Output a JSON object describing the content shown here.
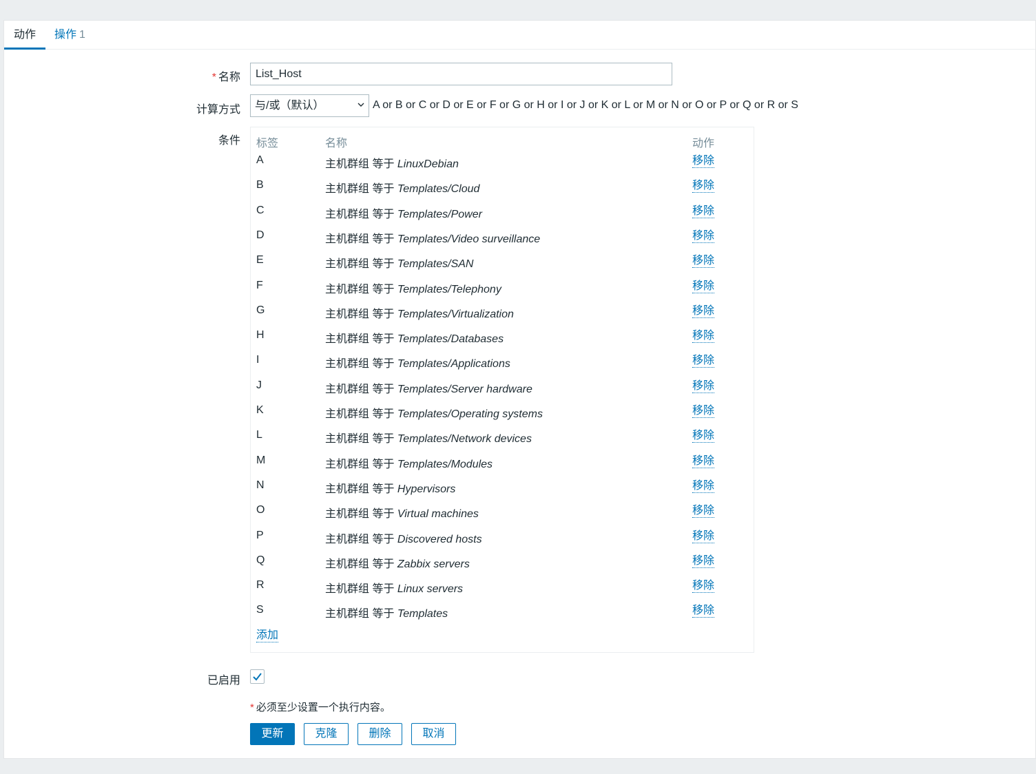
{
  "tabs": [
    {
      "label": "动作"
    },
    {
      "label": "操作",
      "count": "1"
    }
  ],
  "form": {
    "name_label": "名称",
    "required_mark": "*",
    "name_value": "List_Host",
    "calc_label": "计算方式",
    "calc_value": "与/或（默认）",
    "formula": "A or B or C or D or E or F or G or H or I or J or K or L or M or N or O or P or Q or R or S",
    "conditions_label": "条件",
    "enabled_label": "已启用",
    "enabled_checked": true,
    "note": "必须至少设置一个执行内容。"
  },
  "conditions": {
    "headers": {
      "label": "标签",
      "name": "名称",
      "action": "动作"
    },
    "rows": [
      {
        "label": "A",
        "prefix": "主机群组 等于 ",
        "value": "LinuxDebian",
        "action": "移除"
      },
      {
        "label": "B",
        "prefix": "主机群组 等于 ",
        "value": "Templates/Cloud",
        "action": "移除"
      },
      {
        "label": "C",
        "prefix": "主机群组 等于 ",
        "value": "Templates/Power",
        "action": "移除"
      },
      {
        "label": "D",
        "prefix": "主机群组 等于 ",
        "value": "Templates/Video surveillance",
        "action": "移除"
      },
      {
        "label": "E",
        "prefix": "主机群组 等于 ",
        "value": "Templates/SAN",
        "action": "移除"
      },
      {
        "label": "F",
        "prefix": "主机群组 等于 ",
        "value": "Templates/Telephony",
        "action": "移除"
      },
      {
        "label": "G",
        "prefix": "主机群组 等于 ",
        "value": "Templates/Virtualization",
        "action": "移除"
      },
      {
        "label": "H",
        "prefix": "主机群组 等于 ",
        "value": "Templates/Databases",
        "action": "移除"
      },
      {
        "label": "I",
        "prefix": "主机群组 等于 ",
        "value": "Templates/Applications",
        "action": "移除"
      },
      {
        "label": "J",
        "prefix": "主机群组 等于 ",
        "value": "Templates/Server hardware",
        "action": "移除"
      },
      {
        "label": "K",
        "prefix": "主机群组 等于 ",
        "value": "Templates/Operating systems",
        "action": "移除"
      },
      {
        "label": "L",
        "prefix": "主机群组 等于 ",
        "value": "Templates/Network devices",
        "action": "移除"
      },
      {
        "label": "M",
        "prefix": "主机群组 等于 ",
        "value": "Templates/Modules",
        "action": "移除"
      },
      {
        "label": "N",
        "prefix": "主机群组 等于 ",
        "value": "Hypervisors",
        "action": "移除"
      },
      {
        "label": "O",
        "prefix": "主机群组 等于 ",
        "value": "Virtual machines",
        "action": "移除"
      },
      {
        "label": "P",
        "prefix": "主机群组 等于 ",
        "value": "Discovered hosts",
        "action": "移除"
      },
      {
        "label": "Q",
        "prefix": "主机群组 等于 ",
        "value": "Zabbix servers",
        "action": "移除"
      },
      {
        "label": "R",
        "prefix": "主机群组 等于 ",
        "value": "Linux servers",
        "action": "移除"
      },
      {
        "label": "S",
        "prefix": "主机群组 等于 ",
        "value": "Templates",
        "action": "移除"
      }
    ],
    "add_label": "添加"
  },
  "buttons": {
    "update": "更新",
    "clone": "克隆",
    "delete": "删除",
    "cancel": "取消"
  },
  "colors": {
    "accent": "#0275b8",
    "required": "#e33734",
    "background": "#ebeef0"
  }
}
